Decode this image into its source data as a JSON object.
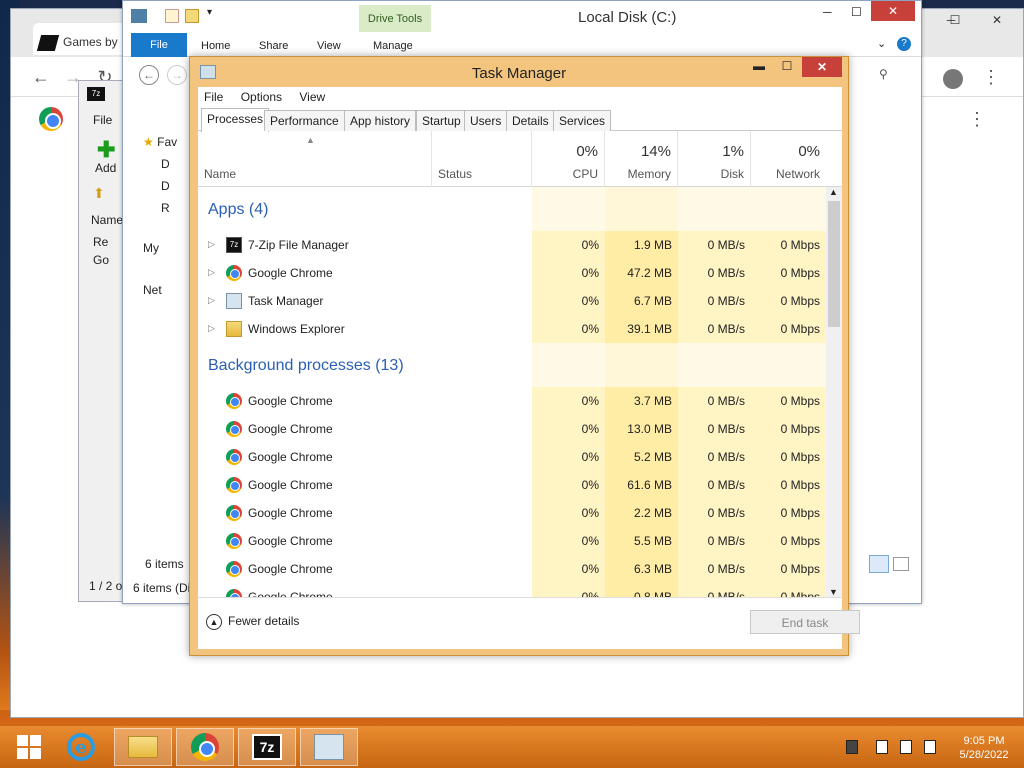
{
  "chrome": {
    "tab_title": "Games by @",
    "back": "←",
    "forward": "→",
    "reload": "↻",
    "minimize": "─",
    "maximize": "☐",
    "close": "✕",
    "menu": "⋮"
  },
  "sevenzip": {
    "menu_file": "File",
    "add_label": "Add",
    "col_name": "Name",
    "item1": "Re",
    "item2": "Go",
    "status": "1 / 2 o"
  },
  "explorer": {
    "title": "Local Disk (C:)",
    "drive_tools": "Drive Tools",
    "ribbon": {
      "file": "File",
      "home": "Home",
      "share": "Share",
      "view": "View",
      "manage": "Manage"
    },
    "nav": {
      "favorites": "Fav",
      "d1": "D",
      "d2": "D",
      "recent": "R",
      "mypc": "My",
      "network": "Net"
    },
    "status_items": "6 items",
    "status_items2": "6 items (Di"
  },
  "taskmanager": {
    "title": "Task Manager",
    "minimize": "▬",
    "maximize": "☐",
    "close": "✕",
    "menu": [
      "File",
      "Options",
      "View"
    ],
    "tabs": [
      "Processes",
      "Performance",
      "App history",
      "Startup",
      "Users",
      "Details",
      "Services"
    ],
    "columns": {
      "name": "Name",
      "status": "Status",
      "cpu_pct": "0%",
      "cpu": "CPU",
      "mem_pct": "14%",
      "mem": "Memory",
      "disk_pct": "1%",
      "disk": "Disk",
      "net_pct": "0%",
      "net": "Network"
    },
    "apps_group": "Apps (4)",
    "apps": [
      {
        "name": "7-Zip File Manager",
        "icon": "7zip-icon",
        "cpu": "0%",
        "mem": "1.9 MB",
        "disk": "0 MB/s",
        "net": "0 Mbps"
      },
      {
        "name": "Google Chrome",
        "icon": "chrome-icon",
        "cpu": "0%",
        "mem": "47.2 MB",
        "disk": "0 MB/s",
        "net": "0 Mbps"
      },
      {
        "name": "Task Manager",
        "icon": "taskmanager-icon",
        "cpu": "0%",
        "mem": "6.7 MB",
        "disk": "0 MB/s",
        "net": "0 Mbps"
      },
      {
        "name": "Windows Explorer",
        "icon": "explorer-icon",
        "cpu": "0%",
        "mem": "39.1 MB",
        "disk": "0 MB/s",
        "net": "0 Mbps"
      }
    ],
    "bg_group": "Background processes (13)",
    "background": [
      {
        "name": "Google Chrome",
        "cpu": "0%",
        "mem": "3.7 MB",
        "disk": "0 MB/s",
        "net": "0 Mbps"
      },
      {
        "name": "Google Chrome",
        "cpu": "0%",
        "mem": "13.0 MB",
        "disk": "0 MB/s",
        "net": "0 Mbps"
      },
      {
        "name": "Google Chrome",
        "cpu": "0%",
        "mem": "5.2 MB",
        "disk": "0 MB/s",
        "net": "0 Mbps"
      },
      {
        "name": "Google Chrome",
        "cpu": "0%",
        "mem": "61.6 MB",
        "disk": "0 MB/s",
        "net": "0 Mbps"
      },
      {
        "name": "Google Chrome",
        "cpu": "0%",
        "mem": "2.2 MB",
        "disk": "0 MB/s",
        "net": "0 Mbps"
      },
      {
        "name": "Google Chrome",
        "cpu": "0%",
        "mem": "5.5 MB",
        "disk": "0 MB/s",
        "net": "0 Mbps"
      },
      {
        "name": "Google Chrome",
        "cpu": "0%",
        "mem": "6.3 MB",
        "disk": "0 MB/s",
        "net": "0 Mbps"
      },
      {
        "name": "Google Chrome",
        "cpu": "0%",
        "mem": "0.8 MB",
        "disk": "0 MB/s",
        "net": "0 Mbps"
      }
    ],
    "fewer_details": "Fewer details",
    "end_task": "End task"
  },
  "taskbar": {
    "time": "9:05 PM",
    "date": "5/28/2022",
    "items": [
      "start-icon",
      "internet-explorer-icon",
      "file-explorer-icon",
      "chrome-icon",
      "7zip-icon",
      "taskmanager-icon"
    ]
  },
  "colors": {
    "accent": "#1979ca",
    "tm_frame": "#f3c47d",
    "close_red": "#c7403a",
    "heat_light": "#fff4c4",
    "heat_mem": "#ffeca5",
    "taskbar": "#d9741c"
  }
}
